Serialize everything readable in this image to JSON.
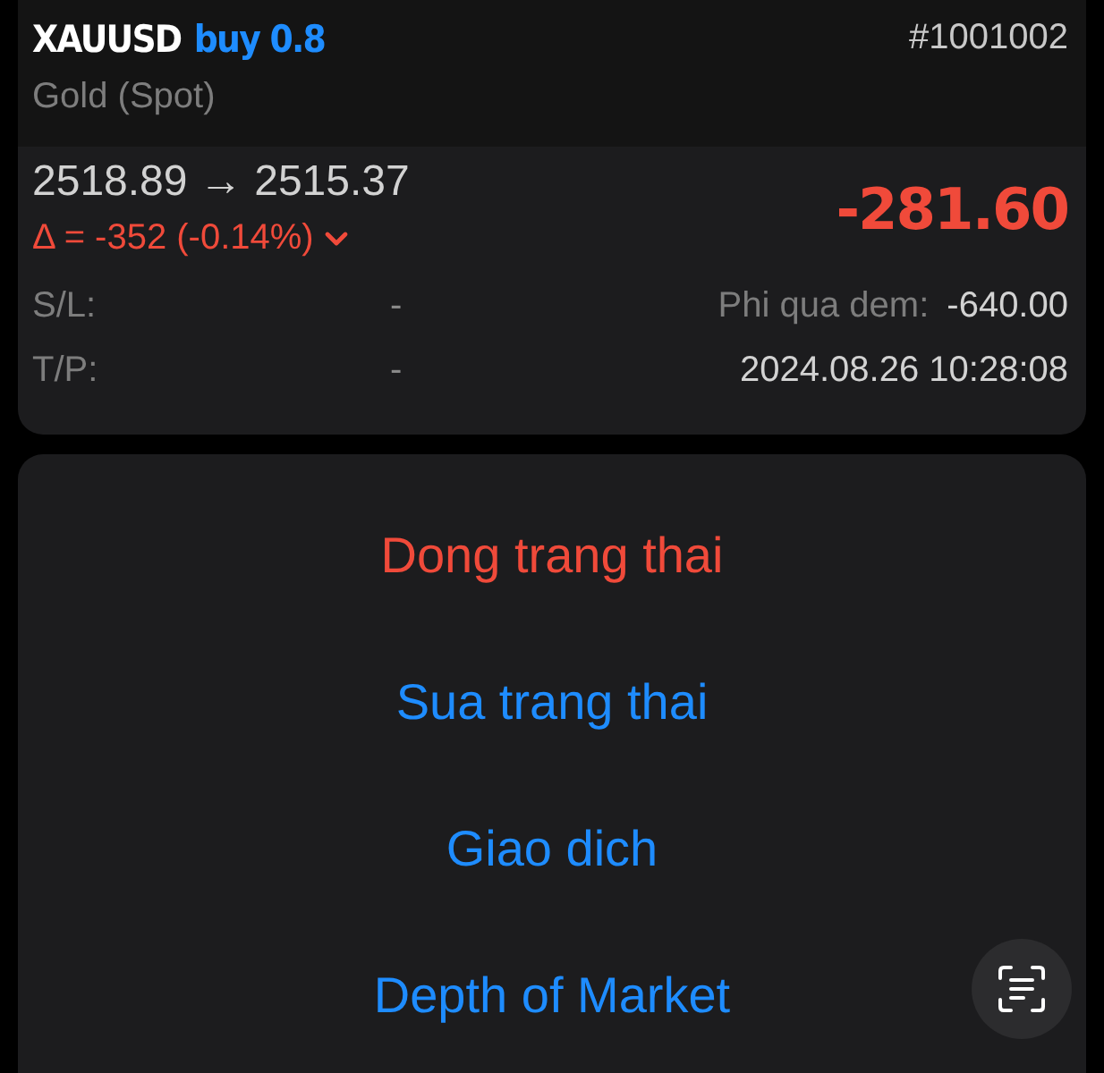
{
  "position": {
    "symbol": "XAUUSD",
    "side": "buy 0.8",
    "ticket": "#1001002",
    "description": "Gold (Spot)",
    "prices": "2518.89 → 2515.37",
    "change": "Δ = -352 (-0.14%)",
    "expanded": false,
    "profit": "-281.60",
    "details": [
      {
        "label": "S/L:",
        "value": "-",
        "label_2": "Phi qua dem:",
        "value_2": "-640.00"
      },
      {
        "label": "T/P:",
        "value": "-",
        "value_2": "2024.08.26 10:28:08"
      }
    ]
  },
  "actions": [
    {
      "label": "Dong trang thai",
      "kind": "destructive"
    },
    {
      "label": "Sua trang thai",
      "kind": "default"
    },
    {
      "label": "Giao dich",
      "kind": "default"
    },
    {
      "label": "Depth of Market",
      "kind": "default"
    }
  ]
}
